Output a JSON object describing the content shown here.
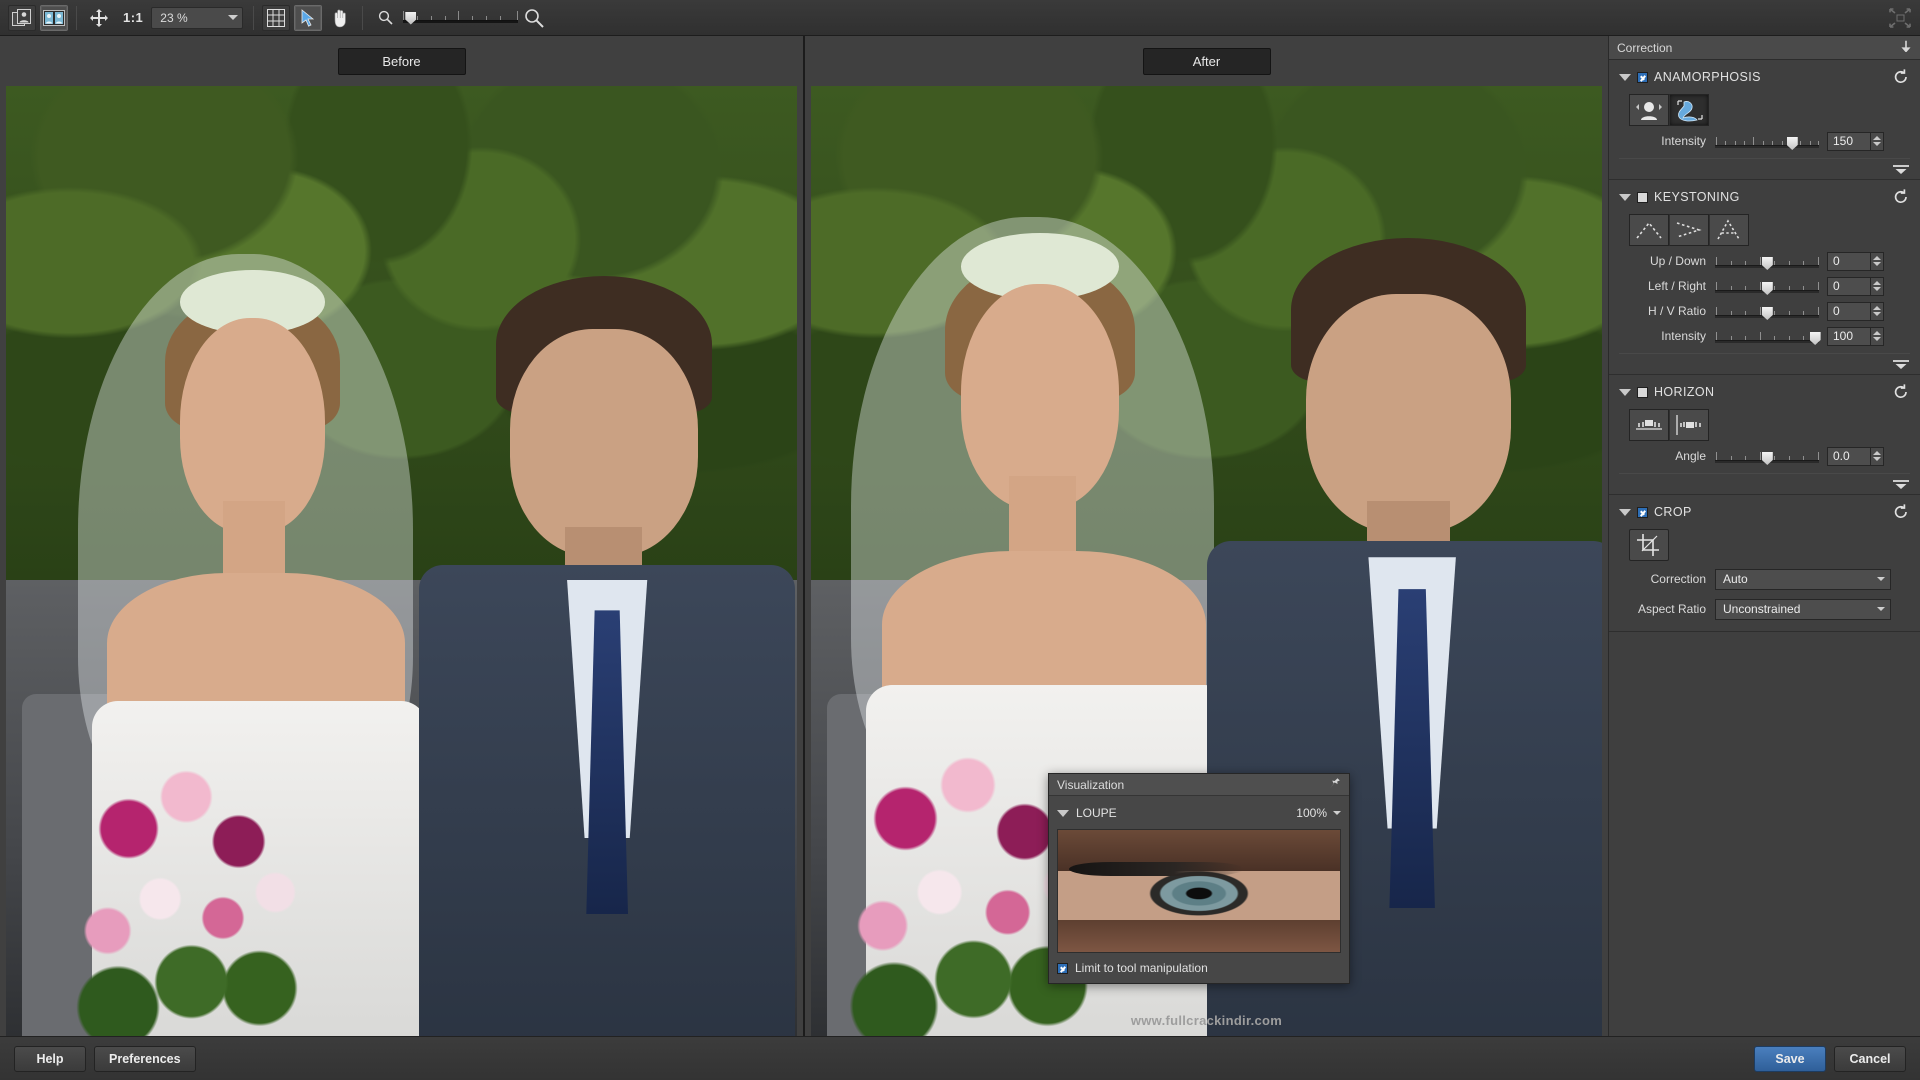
{
  "toolbar": {
    "view_single_icon": "single-view-icon",
    "view_compare_icon": "compare-view-icon",
    "move_icon": "move-tool-icon",
    "one_to_one_label": "1:1",
    "zoom_value": "23 %",
    "grid_icon": "grid-icon",
    "select_icon": "select-arrow-icon",
    "hand_icon": "hand-tool-icon",
    "zoom_out_icon": "zoom-out-icon",
    "zoom_in_icon": "zoom-in-icon",
    "fullscreen_icon": "fullscreen-icon"
  },
  "viewers": {
    "before_label": "Before",
    "after_label": "After",
    "watermark": "www.fullcrackindir.com"
  },
  "right_panel": {
    "title": "Correction",
    "pin_icon": "pin-icon",
    "sections": [
      {
        "name": "ANAMORPHOSIS",
        "checked": true,
        "reset_icon": "reset-icon",
        "tools": [
          "face-restore-icon",
          "shape-restore-icon"
        ],
        "active_tool": 1,
        "sliders": [
          {
            "label": "Intensity",
            "value": "150",
            "pos": 72
          }
        ]
      },
      {
        "name": "KEYSTONING",
        "checked": false,
        "reset_icon": "reset-icon",
        "tools": [
          "keystone-vertical-icon",
          "keystone-horizontal-icon",
          "keystone-full-icon"
        ],
        "active_tool": -1,
        "sliders": [
          {
            "label": "Up / Down",
            "value": "0",
            "pos": 48
          },
          {
            "label": "Left / Right",
            "value": "0",
            "pos": 48
          },
          {
            "label": "H / V Ratio",
            "value": "0",
            "pos": 48
          },
          {
            "label": "Intensity",
            "value": "100",
            "pos": 95
          }
        ]
      },
      {
        "name": "HORIZON",
        "checked": false,
        "reset_icon": "reset-icon",
        "tools": [
          "horizon-horizontal-icon",
          "horizon-vertical-icon"
        ],
        "active_tool": -1,
        "sliders": [
          {
            "label": "Angle",
            "value": "0.0",
            "pos": 48
          }
        ]
      },
      {
        "name": "CROP",
        "checked": true,
        "reset_icon": "reset-icon",
        "tools": [
          "crop-icon"
        ],
        "active_tool": -1,
        "selects": [
          {
            "label": "Correction",
            "value": "Auto"
          },
          {
            "label": "Aspect Ratio",
            "value": "Unconstrained"
          }
        ]
      }
    ]
  },
  "visualization": {
    "title": "Visualization",
    "pin_icon": "pin-icon",
    "loupe_label": "LOUPE",
    "loupe_zoom": "100%",
    "loupe_preview_alt": "eye-closeup-preview",
    "limit_checkbox_label": "Limit to tool manipulation",
    "limit_checked": true
  },
  "bottom_bar": {
    "help_label": "Help",
    "preferences_label": "Preferences",
    "save_label": "Save",
    "cancel_label": "Cancel"
  },
  "colors": {
    "accent_blue": "#2f5f99",
    "panel_bg": "#3f3f3f",
    "toolbar_bg": "#343434"
  }
}
